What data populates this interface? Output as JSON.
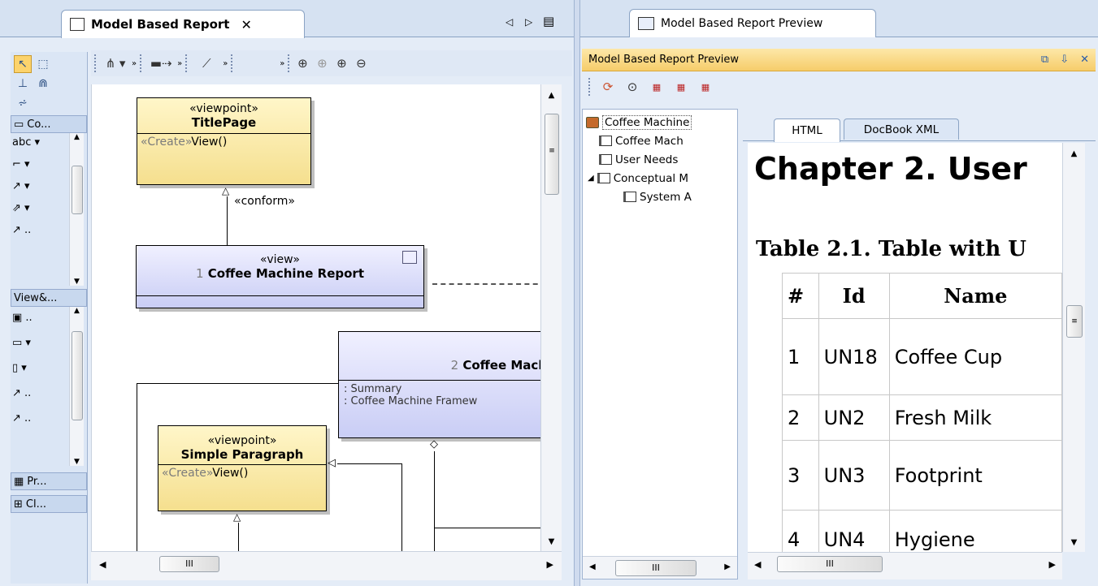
{
  "left": {
    "tab_title": "Model Based Report",
    "palette": {
      "headers": [
        "Co...",
        "View&...",
        "Pr...",
        "Cl..."
      ],
      "text_tool": "abc"
    },
    "diagram": {
      "title_page": {
        "stereotype": "«viewpoint»",
        "name": "TitlePage",
        "op_stereotype": "«Create»",
        "op_name": "View()"
      },
      "conform": "«conform»",
      "report": {
        "stereotype": "«view»",
        "number": "1",
        "name": "Coffee Machine Report"
      },
      "framework": {
        "number": "2",
        "name": "Coffee Mach",
        "attr1": ": Summary",
        "attr2": ": Coffee Machine Framew"
      },
      "simple_para": {
        "stereotype": "«viewpoint»",
        "name": "Simple Paragraph",
        "op_stereotype": "«Create»",
        "op_name": "View()"
      }
    },
    "hscroll": "III"
  },
  "right": {
    "tab_title": "Model Based Report Preview",
    "panel_title": "Model Based Report Preview",
    "tree": [
      {
        "label": "Coffee Machine",
        "level": 0
      },
      {
        "label": "Coffee Mach",
        "level": 1
      },
      {
        "label": "User Needs",
        "level": 1
      },
      {
        "label": "Conceptual M",
        "level": 1
      },
      {
        "label": "System A",
        "level": 2
      }
    ],
    "tabs": [
      "HTML",
      "DocBook XML"
    ],
    "doc": {
      "chapter": "Chapter 2. User",
      "table_caption": "Table 2.1. Table with U",
      "columns": [
        "#",
        "Id",
        "Name"
      ],
      "rows": [
        [
          "1",
          "UN18",
          "Coffee Cup"
        ],
        [
          "2",
          "UN2",
          "Fresh Milk"
        ],
        [
          "3",
          "UN3",
          "Footprint"
        ],
        [
          "4",
          "UN4",
          "Hygiene"
        ]
      ]
    },
    "hscroll": "III"
  }
}
